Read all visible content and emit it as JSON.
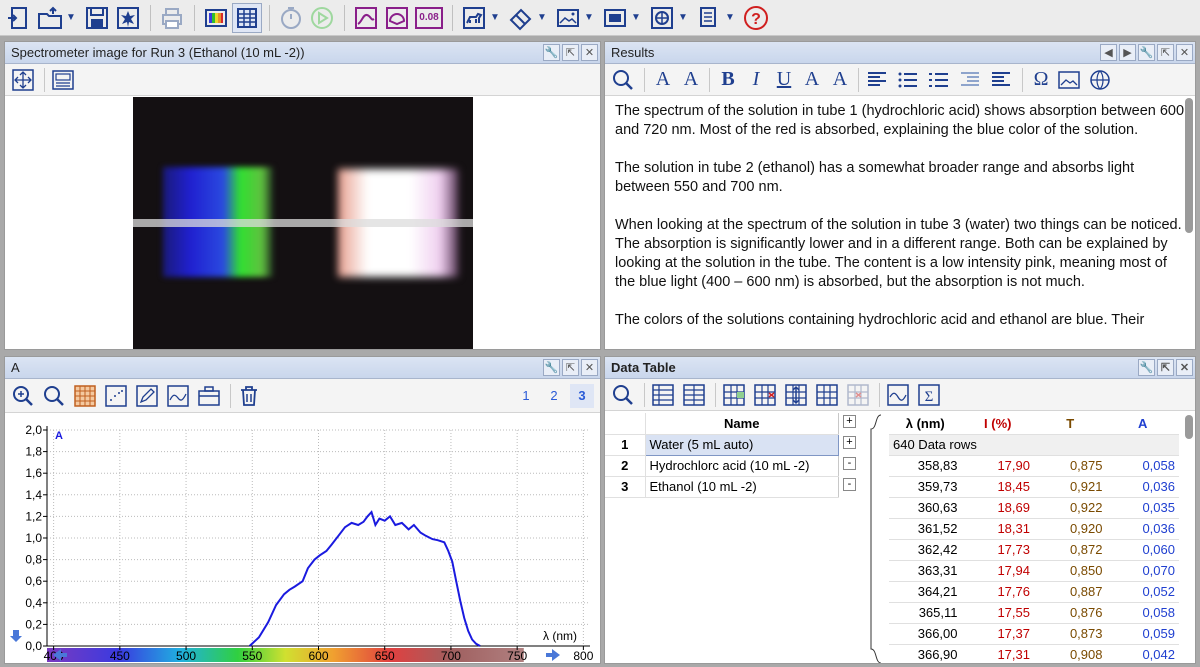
{
  "toolbar": {
    "zoom_value": "0.08"
  },
  "spectrometer_panel": {
    "title": "Spectrometer image for Run 3 (Ethanol (10 mL -2))"
  },
  "results_panel": {
    "title": "Results",
    "paragraphs": [
      "The spectrum of the solution in tube 1 (hydrochloric acid) shows absorption between 600 and 720 nm. Most of the red is absorbed, explaining the blue color of the solution.",
      "The solution in tube 2 (ethanol) has a somewhat broader range and absorbs light between 550 and 700 nm.",
      "When looking at the spectrum of the solution in tube 3 (water) two things can be noticed. The absorption is significantly lower and in a different range. Both can be explained by looking at the solution in the tube. The content is a low intensity pink, meaning most of the blue light (400 – 600 nm) is absorbed, but the absorption is not much.",
      "The colors of the solutions containing hydrochloric acid and ethanol are blue. Their"
    ]
  },
  "graph_panel": {
    "title": "A",
    "pages": [
      "1",
      "2",
      "3"
    ],
    "active_page": "3"
  },
  "chart_data": {
    "type": "line",
    "series_label": "A",
    "xlabel": "λ (nm)",
    "xlim": [
      395,
      805
    ],
    "ylim": [
      0,
      2.0
    ],
    "x_ticks": [
      400,
      450,
      500,
      550,
      600,
      650,
      700,
      750,
      800
    ],
    "x_tick_labels": [
      "400",
      "450",
      "500",
      "550",
      "600",
      "650",
      "700",
      "750",
      "800"
    ],
    "y_ticks": [
      0,
      0.2,
      0.4,
      0.6,
      0.8,
      1.0,
      1.2,
      1.4,
      1.6,
      1.8,
      2.0
    ],
    "y_tick_labels": [
      "0,0",
      "0,2",
      "0,4",
      "0,6",
      "0,8",
      "1,0",
      "1,2",
      "1,4",
      "1,6",
      "1,8",
      "2,0"
    ],
    "grid": true,
    "color": "#1a1adf",
    "x": [
      548,
      555,
      562,
      568,
      574,
      578,
      582,
      588,
      592,
      597,
      601,
      606,
      610,
      615,
      620,
      625,
      630,
      634,
      637,
      640,
      643,
      646,
      650,
      654,
      658,
      663,
      668,
      672,
      677,
      681,
      686,
      690,
      695,
      698,
      701,
      704,
      707,
      710,
      713,
      716,
      719,
      722
    ],
    "y": [
      0.0,
      0.08,
      0.22,
      0.38,
      0.48,
      0.52,
      0.55,
      0.6,
      0.72,
      0.8,
      0.84,
      0.88,
      0.94,
      1.02,
      1.1,
      1.14,
      1.12,
      1.15,
      1.2,
      1.24,
      1.12,
      1.18,
      1.16,
      1.2,
      1.12,
      1.14,
      1.08,
      1.12,
      1.05,
      1.02,
      0.99,
      0.98,
      0.96,
      0.88,
      0.78,
      0.6,
      0.42,
      0.26,
      0.14,
      0.06,
      0.02,
      0.0
    ]
  },
  "data_table": {
    "title": "Data Table",
    "name_header": "Name",
    "runs": [
      {
        "num": "1",
        "name": "Water (5 mL auto)",
        "toggle": "+"
      },
      {
        "num": "2",
        "name": "Hydrochlorc acid (10 mL -2)",
        "toggle": "+"
      },
      {
        "num": "3",
        "name": "Ethanol (10 mL -2)",
        "toggle": "-"
      }
    ],
    "columns": [
      "λ (nm)",
      "I (%)",
      "T",
      "A"
    ],
    "column_colors": [
      "#000000",
      "#c00000",
      "#7a4a00",
      "#1f3fd0"
    ],
    "rows_label": "640 Data rows",
    "rows": [
      [
        "358,83",
        "17,90",
        "0,875",
        "0,058"
      ],
      [
        "359,73",
        "18,45",
        "0,921",
        "0,036"
      ],
      [
        "360,63",
        "18,69",
        "0,922",
        "0,035"
      ],
      [
        "361,52",
        "18,31",
        "0,920",
        "0,036"
      ],
      [
        "362,42",
        "17,73",
        "0,872",
        "0,060"
      ],
      [
        "363,31",
        "17,94",
        "0,850",
        "0,070"
      ],
      [
        "364,21",
        "17,76",
        "0,887",
        "0,052"
      ],
      [
        "365,11",
        "17,55",
        "0,876",
        "0,058"
      ],
      [
        "366,00",
        "17,37",
        "0,873",
        "0,059"
      ],
      [
        "366,90",
        "17,31",
        "0,908",
        "0,042"
      ]
    ]
  }
}
